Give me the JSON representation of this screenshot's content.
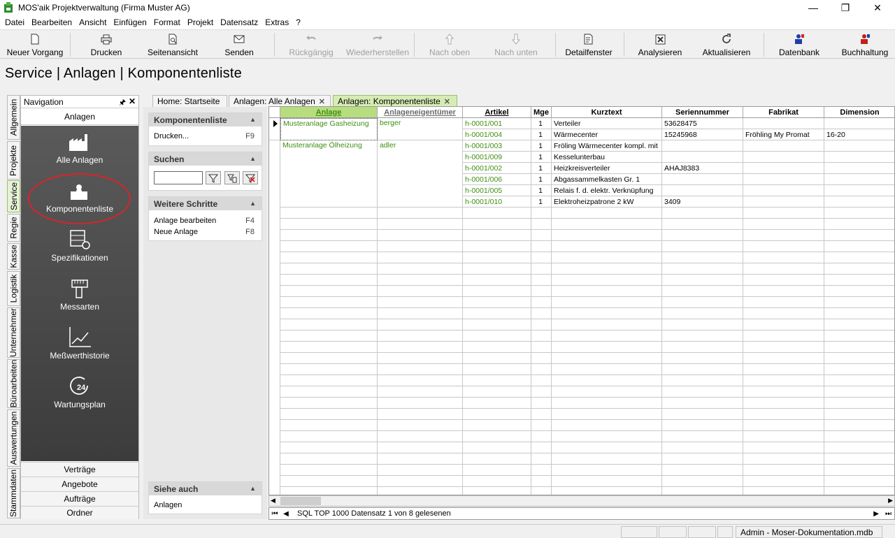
{
  "window": {
    "title": "MOS'aik Projektverwaltung (Firma Muster AG)",
    "controls": {
      "minimize": "—",
      "maximize": "❐",
      "close": "✕"
    }
  },
  "menu": [
    "Datei",
    "Bearbeiten",
    "Ansicht",
    "Einfügen",
    "Format",
    "Projekt",
    "Datensatz",
    "Extras",
    "?"
  ],
  "toolbar": {
    "new": "Neuer Vorgang",
    "print": "Drucken",
    "preview": "Seitenansicht",
    "send": "Senden",
    "undo": "Rückgängig",
    "redo": "Wiederherstellen",
    "up": "Nach oben",
    "down": "Nach unten",
    "detail": "Detailfenster",
    "analyze": "Analysieren",
    "refresh": "Aktualisieren",
    "database": "Datenbank",
    "accounting": "Buchhaltung"
  },
  "page_title": "Service | Anlagen | Komponentenliste",
  "side_tabs": [
    "Allgemein",
    "Projekte",
    "Service",
    "Regie",
    "Kasse",
    "Logistik",
    "Unternehmer",
    "Büroarbeiten",
    "Auswertungen",
    "Stammdaten"
  ],
  "navigation": {
    "header": "Navigation",
    "pin": "🖈",
    "close": "✕",
    "group": "Anlagen",
    "items": [
      "Alle Anlagen",
      "Komponentenliste",
      "Spezifikationen",
      "Messarten",
      "Meßwerthistorie",
      "Wartungsplan"
    ],
    "bottom": [
      "Verträge",
      "Angebote",
      "Aufträge",
      "Ordner"
    ]
  },
  "tasks": {
    "komponentenliste": {
      "title": "Komponentenliste",
      "print": "Drucken...",
      "print_key": "F9"
    },
    "search": {
      "title": "Suchen",
      "value": ""
    },
    "next": {
      "title": "Weitere Schritte",
      "edit": "Anlage bearbeiten",
      "edit_key": "F4",
      "new": "Neue Anlage",
      "new_key": "F8"
    },
    "see_also": {
      "title": "Siehe auch",
      "link": "Anlagen"
    },
    "caret": "▲"
  },
  "tabs": [
    {
      "label": "Home: Startseite",
      "close": ""
    },
    {
      "label": "Anlagen: Alle Anlagen",
      "close": "✕"
    },
    {
      "label": "Anlagen: Komponentenliste",
      "close": "✕"
    }
  ],
  "grid": {
    "columns": [
      "Anlage",
      "Anlageneigentümer",
      "Artikel",
      "Mge",
      "Kurztext",
      "Seriennummer",
      "Fabrikat",
      "Dimension"
    ],
    "groups": [
      {
        "anlage": "Musteranlage Gasheizung",
        "owner": "berger"
      },
      {
        "anlage": "Musteranlage Ölheizung",
        "owner": "adler"
      }
    ],
    "rows": [
      {
        "artikel": "h-0001/001",
        "mge": "1",
        "kurztext": "Verteiler",
        "serie": "53628475",
        "fabrikat": "",
        "dimension": ""
      },
      {
        "artikel": "h-0001/004",
        "mge": "1",
        "kurztext": "Wärmecenter",
        "serie": "15245968",
        "fabrikat": "Fröhling My Promat",
        "dimension": "16-20"
      },
      {
        "artikel": "h-0001/003",
        "mge": "1",
        "kurztext": "Fröling Wärmecenter kompl. mit",
        "serie": "",
        "fabrikat": "",
        "dimension": ""
      },
      {
        "artikel": "h-0001/009",
        "mge": "1",
        "kurztext": "Kesselunterbau",
        "serie": "",
        "fabrikat": "",
        "dimension": ""
      },
      {
        "artikel": "h-0001/002",
        "mge": "1",
        "kurztext": "Heizkreisverteiler",
        "serie": "AHAJ8383",
        "fabrikat": "",
        "dimension": ""
      },
      {
        "artikel": "h-0001/006",
        "mge": "1",
        "kurztext": "Abgassammelkasten Gr. 1",
        "serie": "",
        "fabrikat": "",
        "dimension": ""
      },
      {
        "artikel": "h-0001/005",
        "mge": "1",
        "kurztext": "Relais f. d. elektr. Verknüpfung",
        "serie": "",
        "fabrikat": "",
        "dimension": ""
      },
      {
        "artikel": "h-0001/010",
        "mge": "1",
        "kurztext": "Elektroheizpatrone 2 kW",
        "serie": "3409",
        "fabrikat": "",
        "dimension": ""
      }
    ]
  },
  "footer": {
    "status": "SQL TOP 1000 Datensatz 1 von 8 gelesenen"
  },
  "statusbar": {
    "right": "Admin - Moser-Dokumentation.mdb"
  },
  "colors": {
    "accent_green": "#3f8f10",
    "active_tab": "#d7ecb5",
    "highlight_ring": "#d8242a"
  }
}
